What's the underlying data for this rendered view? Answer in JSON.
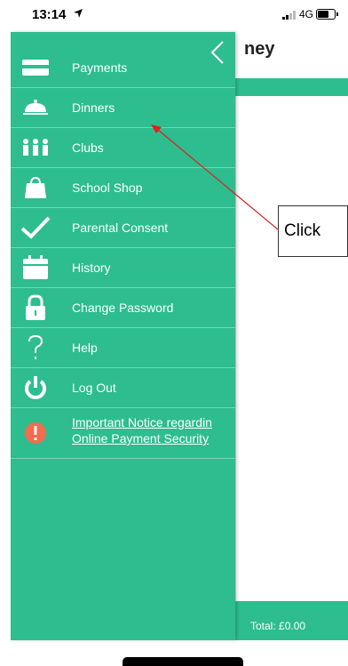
{
  "status_bar": {
    "time": "13:14",
    "network": "4G"
  },
  "background": {
    "title": "ney",
    "total": "Total: £0.00"
  },
  "callout": {
    "text": "Click"
  },
  "menu": {
    "items": [
      {
        "label": "Payments",
        "icon": "card-icon"
      },
      {
        "label": "Dinners",
        "icon": "cloche-icon"
      },
      {
        "label": "Clubs",
        "icon": "people-icon"
      },
      {
        "label": "School Shop",
        "icon": "shopping-bag-icon"
      },
      {
        "label": "Parental Consent",
        "icon": "checkmark-icon"
      },
      {
        "label": "History",
        "icon": "calendar-icon"
      },
      {
        "label": "Change Password",
        "icon": "lock-icon"
      },
      {
        "label": "Help",
        "icon": "question-icon"
      },
      {
        "label": "Log Out",
        "icon": "power-icon"
      }
    ],
    "notice": {
      "line1": "Important Notice regardin",
      "line2": "Online Payment Security",
      "icon": "alert-icon",
      "icon_color": "#f26c4f"
    }
  },
  "colors": {
    "accent": "#2dbd8f",
    "arrow": "#e0201b"
  }
}
